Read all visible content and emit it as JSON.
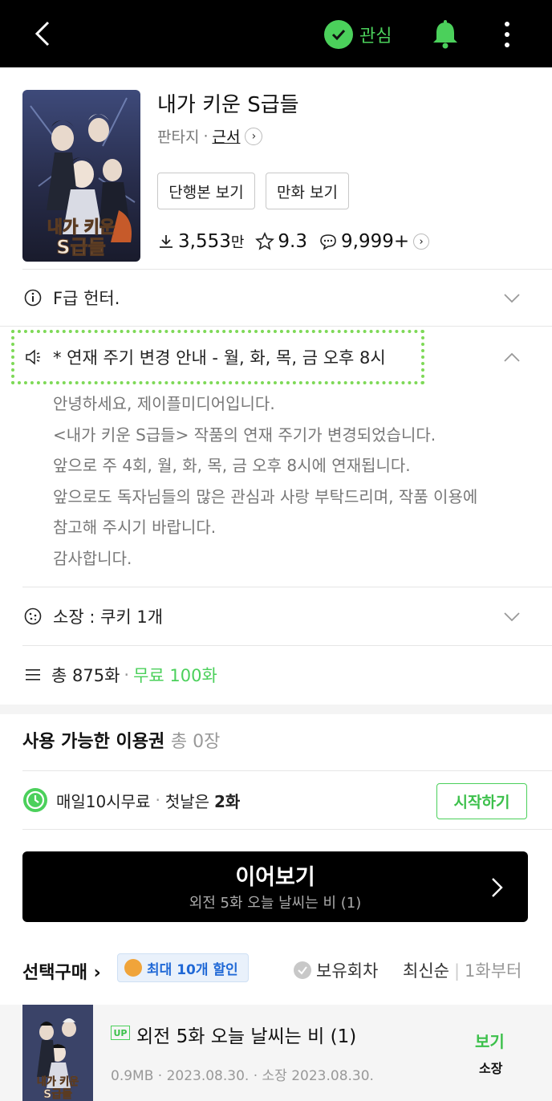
{
  "topbar": {
    "interest_label": "관심",
    "accent_color": "#4bd05b"
  },
  "work": {
    "title": "내가 키운 S급들",
    "genre": "판타지",
    "separator": "·",
    "author": "근서",
    "buttons": {
      "volume": "단행본 보기",
      "comic": "만화 보기"
    },
    "stats": {
      "downloads_num": "3,553",
      "downloads_unit": "만",
      "rating": "9.3",
      "comments": "9,999+"
    },
    "cover_text": "내가 키운 S급들"
  },
  "info_rows": {
    "hunter": "F급 헌터.",
    "notice_title": "* 연재 주기 변경 안내 - 월, 화, 목, 금 오후 8시",
    "notice_lines": [
      "안녕하세요, 제이플미디어입니다.",
      "<내가 키운 S급들> 작품의 연재 주기가 변경되었습니다.",
      "앞으로 주 4회, 월, 화, 목, 금 오후 8시에 연재됩니다.",
      "앞으로도 독자님들의 많은 관심과 사랑 부탁드리며, 작품 이용에",
      "참고해 주시기 바랍니다.",
      "감사합니다."
    ],
    "owned": "소장 : 쿠키 1개",
    "total": "총 875화",
    "free": "무료 100화"
  },
  "pass": {
    "title": "사용 가능한 이용권",
    "count": "총 0장",
    "daily_label": "매일10시무료",
    "first_day_label": "첫날은",
    "first_day_value": "2화",
    "start_button": "시작하기"
  },
  "continue": {
    "label": "이어보기",
    "episode": "외전 5화 오늘 날씨는 비 (1)"
  },
  "select": {
    "title": "선택구매",
    "discount": "최대 10개 할인",
    "owned_filter": "보유회차",
    "sort": "최신순",
    "from_first": "1화부터"
  },
  "episodes": [
    {
      "badge": "UP",
      "title": "외전 5화 오늘 날씨는 비 (1)",
      "meta": "0.9MB · 2023.08.30. · 소장 2023.08.30.",
      "view": "보기",
      "owned": "소장"
    }
  ]
}
